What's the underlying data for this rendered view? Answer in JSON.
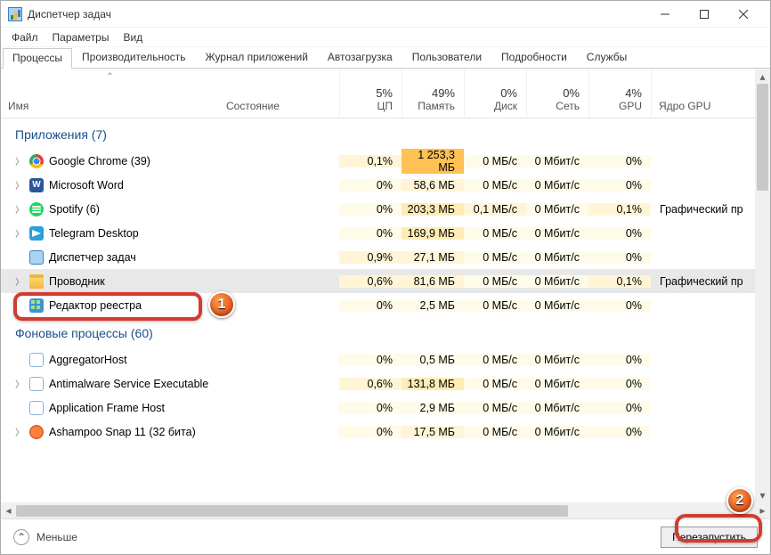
{
  "window": {
    "title": "Диспетчер задач"
  },
  "menus": [
    "Файл",
    "Параметры",
    "Вид"
  ],
  "tabs": [
    "Процессы",
    "Производительность",
    "Журнал приложений",
    "Автозагрузка",
    "Пользователи",
    "Подробности",
    "Службы"
  ],
  "columns": {
    "name": "Имя",
    "state": "Состояние",
    "gpuengine": "Ядро GPU",
    "metrics": [
      {
        "pct": "5%",
        "label": "ЦП"
      },
      {
        "pct": "49%",
        "label": "Память"
      },
      {
        "pct": "0%",
        "label": "Диск"
      },
      {
        "pct": "0%",
        "label": "Сеть"
      },
      {
        "pct": "4%",
        "label": "GPU"
      }
    ]
  },
  "groups": [
    {
      "title": "Приложения (7)",
      "rows": [
        {
          "expand": true,
          "icon": "i-chrome",
          "name": "Google Chrome (39)",
          "cpu": "0,1%",
          "cpuH": "h1",
          "mem": "1 253,3 МБ",
          "memH": "h4",
          "disk": "0 МБ/с",
          "diskH": "h0",
          "net": "0 Мбит/с",
          "netH": "h0",
          "gpu": "0%",
          "gpuH": "h0",
          "eng": "",
          "selected": false
        },
        {
          "expand": true,
          "icon": "i-word",
          "iconText": "W",
          "name": "Microsoft Word",
          "cpu": "0%",
          "cpuH": "h0",
          "mem": "58,6 МБ",
          "memH": "h1",
          "disk": "0 МБ/с",
          "diskH": "h0",
          "net": "0 Мбит/с",
          "netH": "h0",
          "gpu": "0%",
          "gpuH": "h0",
          "eng": "",
          "selected": false
        },
        {
          "expand": true,
          "icon": "i-spotify",
          "name": "Spotify (6)",
          "cpu": "0%",
          "cpuH": "h0",
          "mem": "203,3 МБ",
          "memH": "h2",
          "disk": "0,1 МБ/с",
          "diskH": "h1",
          "net": "0 Мбит/с",
          "netH": "h0",
          "gpu": "0,1%",
          "gpuH": "h1",
          "eng": "Графический пр",
          "selected": false
        },
        {
          "expand": true,
          "icon": "i-telegram",
          "name": "Telegram Desktop",
          "cpu": "0%",
          "cpuH": "h0",
          "mem": "169,9 МБ",
          "memH": "h2",
          "disk": "0 МБ/с",
          "diskH": "h0",
          "net": "0 Мбит/с",
          "netH": "h0",
          "gpu": "0%",
          "gpuH": "h0",
          "eng": "",
          "selected": false
        },
        {
          "expand": false,
          "icon": "i-tm",
          "name": "Диспетчер задач",
          "cpu": "0,9%",
          "cpuH": "h1",
          "mem": "27,1 МБ",
          "memH": "h1",
          "disk": "0 МБ/с",
          "diskH": "h0",
          "net": "0 Мбит/с",
          "netH": "h0",
          "gpu": "0%",
          "gpuH": "h0",
          "eng": "",
          "selected": false
        },
        {
          "expand": true,
          "icon": "i-explorer",
          "name": "Проводник",
          "cpu": "0,6%",
          "cpuH": "h1",
          "mem": "81,6 МБ",
          "memH": "h1",
          "disk": "0 МБ/с",
          "diskH": "h0",
          "net": "0 Мбит/с",
          "netH": "h0",
          "gpu": "0,1%",
          "gpuH": "h1",
          "eng": "Графический пр",
          "selected": true
        },
        {
          "expand": false,
          "icon": "i-regedit",
          "name": "Редактор реестра",
          "cpu": "0%",
          "cpuH": "h0",
          "mem": "2,5 МБ",
          "memH": "h0",
          "disk": "0 МБ/с",
          "diskH": "h0",
          "net": "0 Мбит/с",
          "netH": "h0",
          "gpu": "0%",
          "gpuH": "h0",
          "eng": "",
          "selected": false
        }
      ]
    },
    {
      "title": "Фоновые процессы (60)",
      "rows": [
        {
          "expand": false,
          "icon": "i-generic",
          "name": "AggregatorHost",
          "cpu": "0%",
          "cpuH": "h0",
          "mem": "0,5 МБ",
          "memH": "h0",
          "disk": "0 МБ/с",
          "diskH": "h0",
          "net": "0 Мбит/с",
          "netH": "h0",
          "gpu": "0%",
          "gpuH": "h0",
          "eng": "",
          "selected": false
        },
        {
          "expand": true,
          "icon": "i-generic",
          "name": "Antimalware Service Executable",
          "cpu": "0,6%",
          "cpuH": "h1",
          "mem": "131,8 МБ",
          "memH": "h2",
          "disk": "0 МБ/с",
          "diskH": "h0",
          "net": "0 Мбит/с",
          "netH": "h0",
          "gpu": "0%",
          "gpuH": "h0",
          "eng": "",
          "selected": false
        },
        {
          "expand": false,
          "icon": "i-generic",
          "name": "Application Frame Host",
          "cpu": "0%",
          "cpuH": "h0",
          "mem": "2,9 МБ",
          "memH": "h0",
          "disk": "0 МБ/с",
          "diskH": "h0",
          "net": "0 Мбит/с",
          "netH": "h0",
          "gpu": "0%",
          "gpuH": "h0",
          "eng": "",
          "selected": false
        },
        {
          "expand": true,
          "icon": "i-ashampoo",
          "name": "Ashampoo Snap 11 (32 бита)",
          "cpu": "0%",
          "cpuH": "h0",
          "mem": "17,5 МБ",
          "memH": "h1",
          "disk": "0 МБ/с",
          "diskH": "h0",
          "net": "0 Мбит/с",
          "netH": "h0",
          "gpu": "0%",
          "gpuH": "h0",
          "eng": "",
          "selected": false
        }
      ]
    }
  ],
  "footer": {
    "fewer": "Меньше",
    "action": "Перезапустить"
  }
}
